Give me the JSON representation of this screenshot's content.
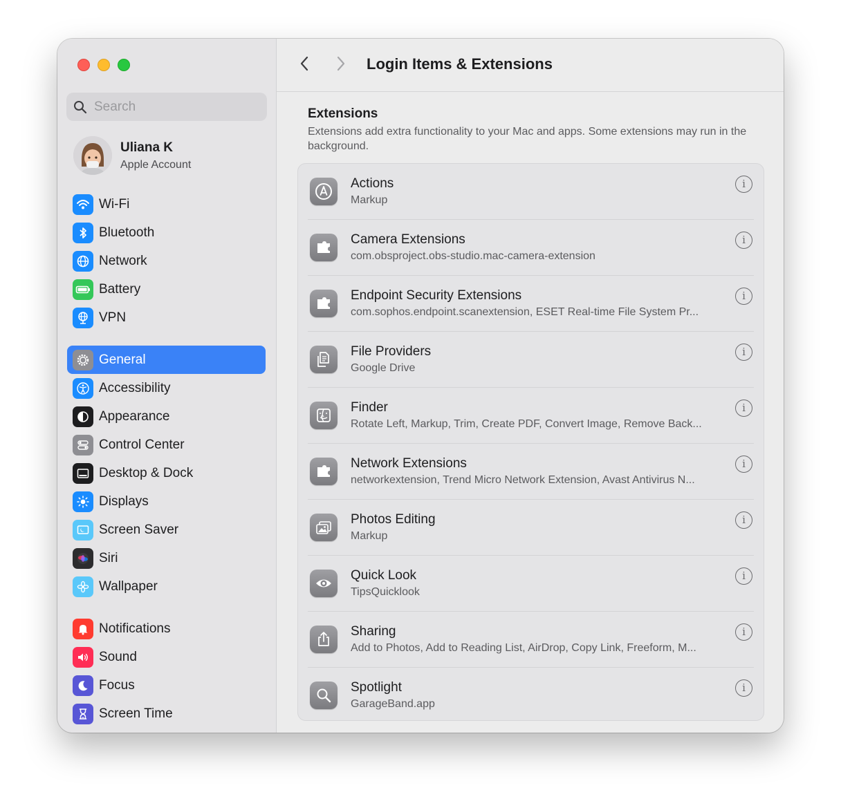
{
  "sidebar": {
    "search": {
      "placeholder": "Search"
    },
    "account": {
      "name": "Uliana K",
      "subtitle": "Apple Account"
    },
    "items": [
      {
        "label": "Wi-Fi",
        "icon": "wifi-icon",
        "color": "#1a8cff"
      },
      {
        "label": "Bluetooth",
        "icon": "bluetooth-icon",
        "color": "#1a8cff"
      },
      {
        "label": "Network",
        "icon": "globe-icon",
        "color": "#1a8cff"
      },
      {
        "label": "Battery",
        "icon": "battery-icon",
        "color": "#34c759"
      },
      {
        "label": "VPN",
        "icon": "vpn-globe-icon",
        "color": "#1a8cff"
      },
      {
        "label": "General",
        "icon": "gear-icon",
        "color": "#8e8e93",
        "selected": true
      },
      {
        "label": "Accessibility",
        "icon": "accessibility-icon",
        "color": "#1a8cff"
      },
      {
        "label": "Appearance",
        "icon": "appearance-icon",
        "color": "#1d1d1f"
      },
      {
        "label": "Control Center",
        "icon": "control-center-icon",
        "color": "#8e8e93"
      },
      {
        "label": "Desktop & Dock",
        "icon": "dock-icon",
        "color": "#1d1d1f"
      },
      {
        "label": "Displays",
        "icon": "sun-icon",
        "color": "#1a8cff"
      },
      {
        "label": "Screen Saver",
        "icon": "screen-saver-icon",
        "color": "#5ac8fa"
      },
      {
        "label": "Siri",
        "icon": "siri-icon",
        "color": "#2c2c2e"
      },
      {
        "label": "Wallpaper",
        "icon": "flower-icon",
        "color": "#5ac8fa"
      },
      {
        "label": "Notifications",
        "icon": "bell-icon",
        "color": "#ff3b30"
      },
      {
        "label": "Sound",
        "icon": "speaker-icon",
        "color": "#ff2d55"
      },
      {
        "label": "Focus",
        "icon": "moon-icon",
        "color": "#5856d6"
      },
      {
        "label": "Screen Time",
        "icon": "hourglass-icon",
        "color": "#5856d6"
      }
    ]
  },
  "toolbar": {
    "title": "Login Items & Extensions"
  },
  "section": {
    "title": "Extensions",
    "description": "Extensions add extra functionality to your Mac and apps. Some extensions may run in the background."
  },
  "extensions": [
    {
      "title": "Actions",
      "subtitle": "Markup",
      "icon": "markup-icon"
    },
    {
      "title": "Camera Extensions",
      "subtitle": "com.obsproject.obs-studio.mac-camera-extension",
      "icon": "puzzle-icon"
    },
    {
      "title": "Endpoint Security Extensions",
      "subtitle": "com.sophos.endpoint.scanextension, ESET Real-time File System Pr...",
      "icon": "puzzle-icon"
    },
    {
      "title": "File Providers",
      "subtitle": "Google Drive",
      "icon": "documents-icon"
    },
    {
      "title": "Finder",
      "subtitle": "Rotate Left, Markup, Trim, Create PDF, Convert Image, Remove Back...",
      "icon": "finder-icon"
    },
    {
      "title": "Network Extensions",
      "subtitle": "networkextension, Trend Micro Network Extension, Avast Antivirus N...",
      "icon": "puzzle-icon"
    },
    {
      "title": "Photos Editing",
      "subtitle": "Markup",
      "icon": "photos-icon"
    },
    {
      "title": "Quick Look",
      "subtitle": "TipsQuicklook",
      "icon": "eye-icon"
    },
    {
      "title": "Sharing",
      "subtitle": "Add to Photos, Add to Reading List, AirDrop, Copy Link, Freeform, M...",
      "icon": "share-icon"
    },
    {
      "title": "Spotlight",
      "subtitle": "GarageBand.app",
      "icon": "magnifier-icon"
    }
  ],
  "info_glyph": "i"
}
